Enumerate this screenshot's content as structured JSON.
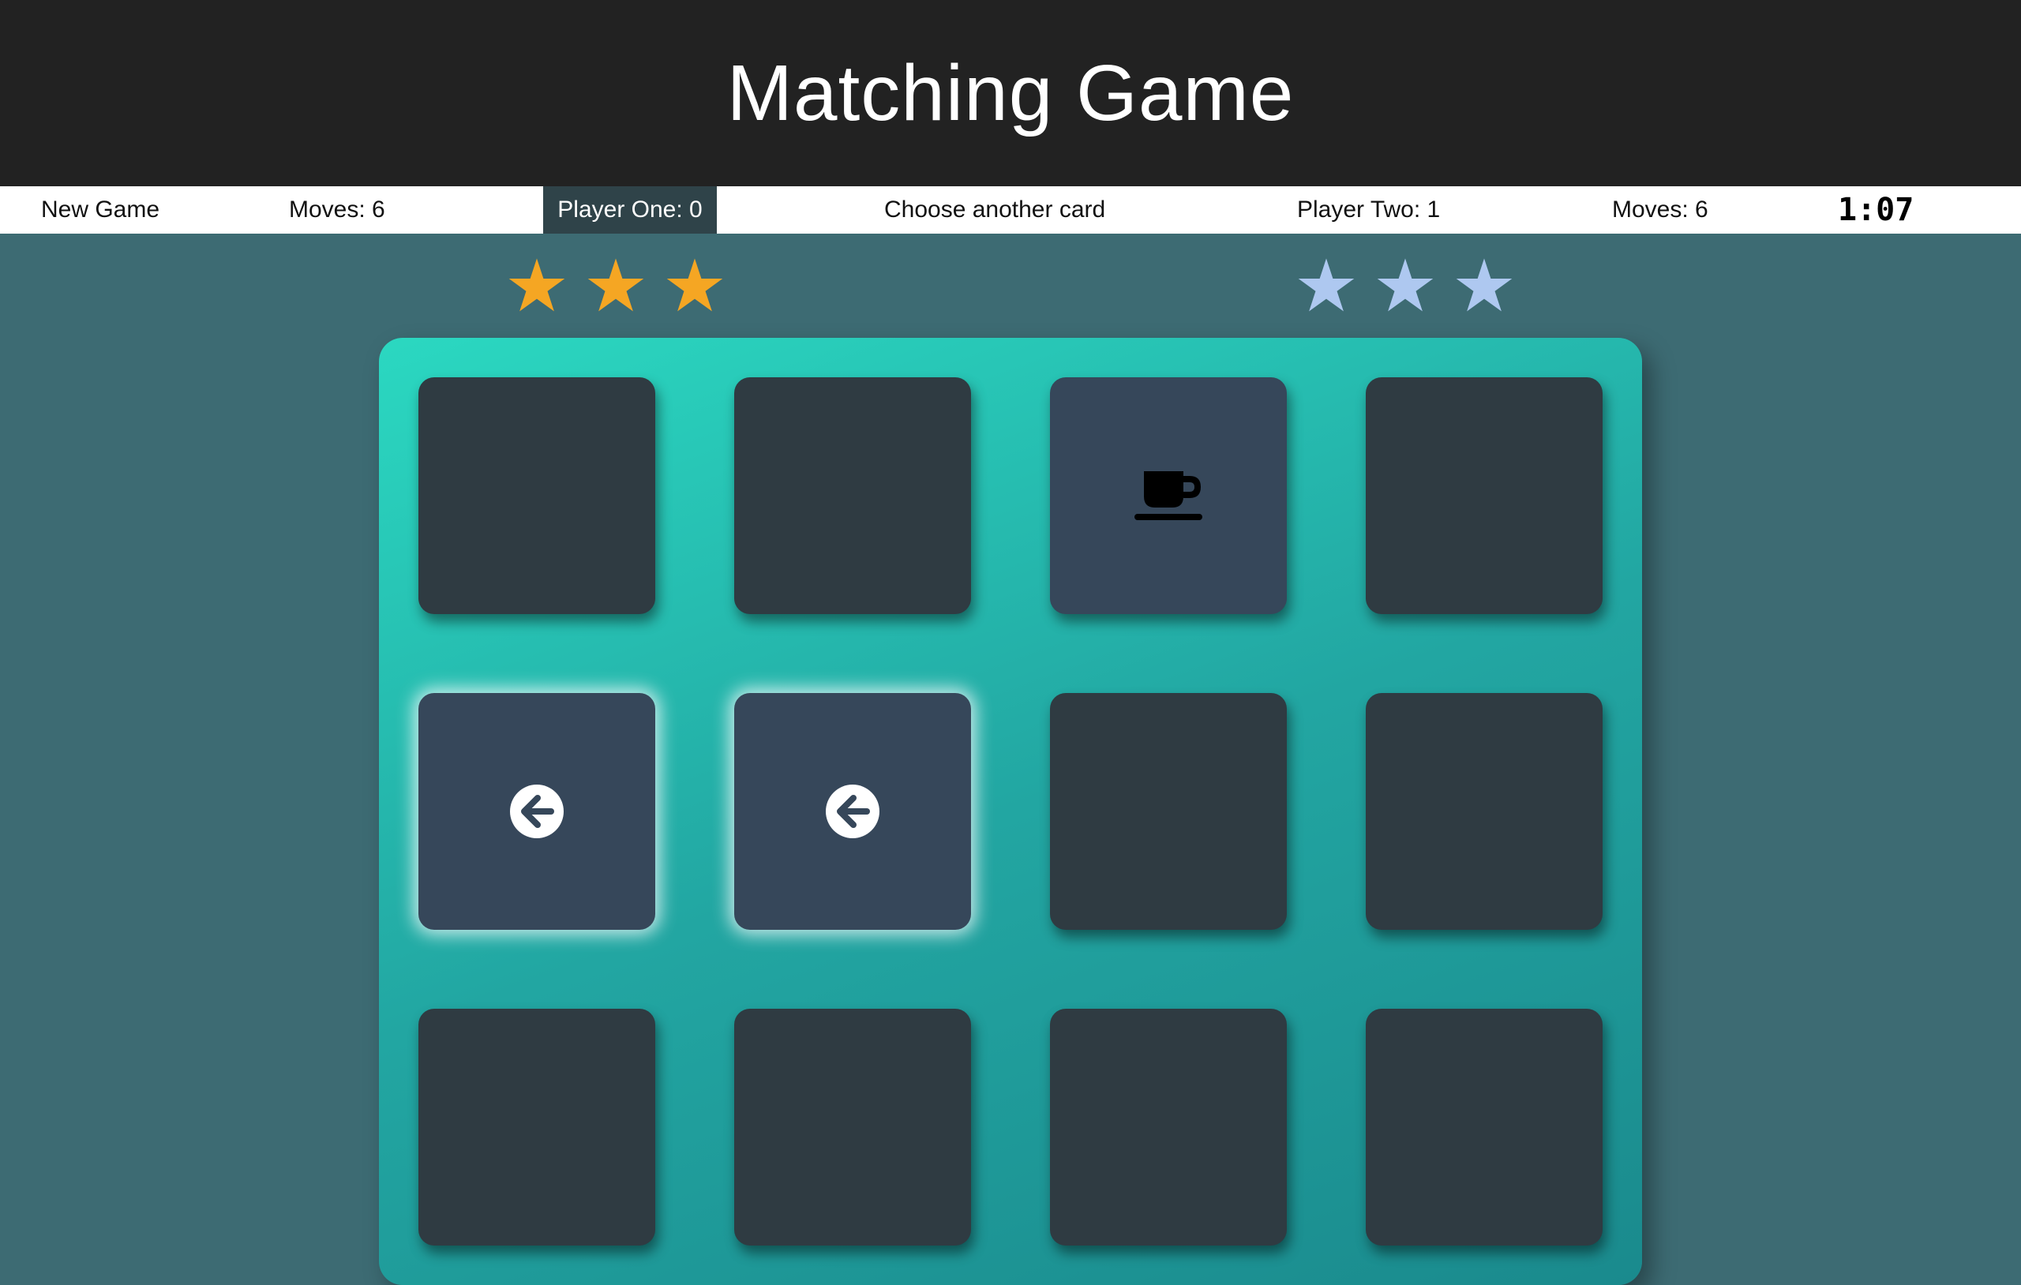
{
  "header": {
    "title": "Matching Game"
  },
  "scorebar": {
    "new_game_label": "New Game",
    "player_one_moves": "Moves: 6",
    "player_one_label": "Player One: 0",
    "status": "Choose another card",
    "player_two_label": "Player Two: 1",
    "player_two_moves": "Moves: 6",
    "timer": "1:07"
  },
  "players": {
    "one": {
      "stars": 3,
      "star_glyph": "★",
      "color": "#f5a623"
    },
    "two": {
      "stars": 3,
      "star_glyph": "★",
      "color": "#aec8f0"
    }
  },
  "colors": {
    "background": "#3d6b73",
    "header": "#222222",
    "card_back": "#2f3b42",
    "card_face": "#36475a",
    "active_player_tab": "#2f4349"
  },
  "board": {
    "rows": 3,
    "columns": 4,
    "cards": [
      {
        "state": "hidden",
        "icon": ""
      },
      {
        "state": "hidden",
        "icon": ""
      },
      {
        "state": "open",
        "icon": "coffee-cup-icon"
      },
      {
        "state": "hidden",
        "icon": ""
      },
      {
        "state": "open-selected",
        "icon": "arrow-circle-left-icon"
      },
      {
        "state": "open-selected",
        "icon": "arrow-circle-left-icon"
      },
      {
        "state": "hidden",
        "icon": ""
      },
      {
        "state": "hidden",
        "icon": ""
      },
      {
        "state": "hidden",
        "icon": ""
      },
      {
        "state": "hidden",
        "icon": ""
      },
      {
        "state": "hidden",
        "icon": ""
      },
      {
        "state": "hidden",
        "icon": ""
      }
    ]
  }
}
